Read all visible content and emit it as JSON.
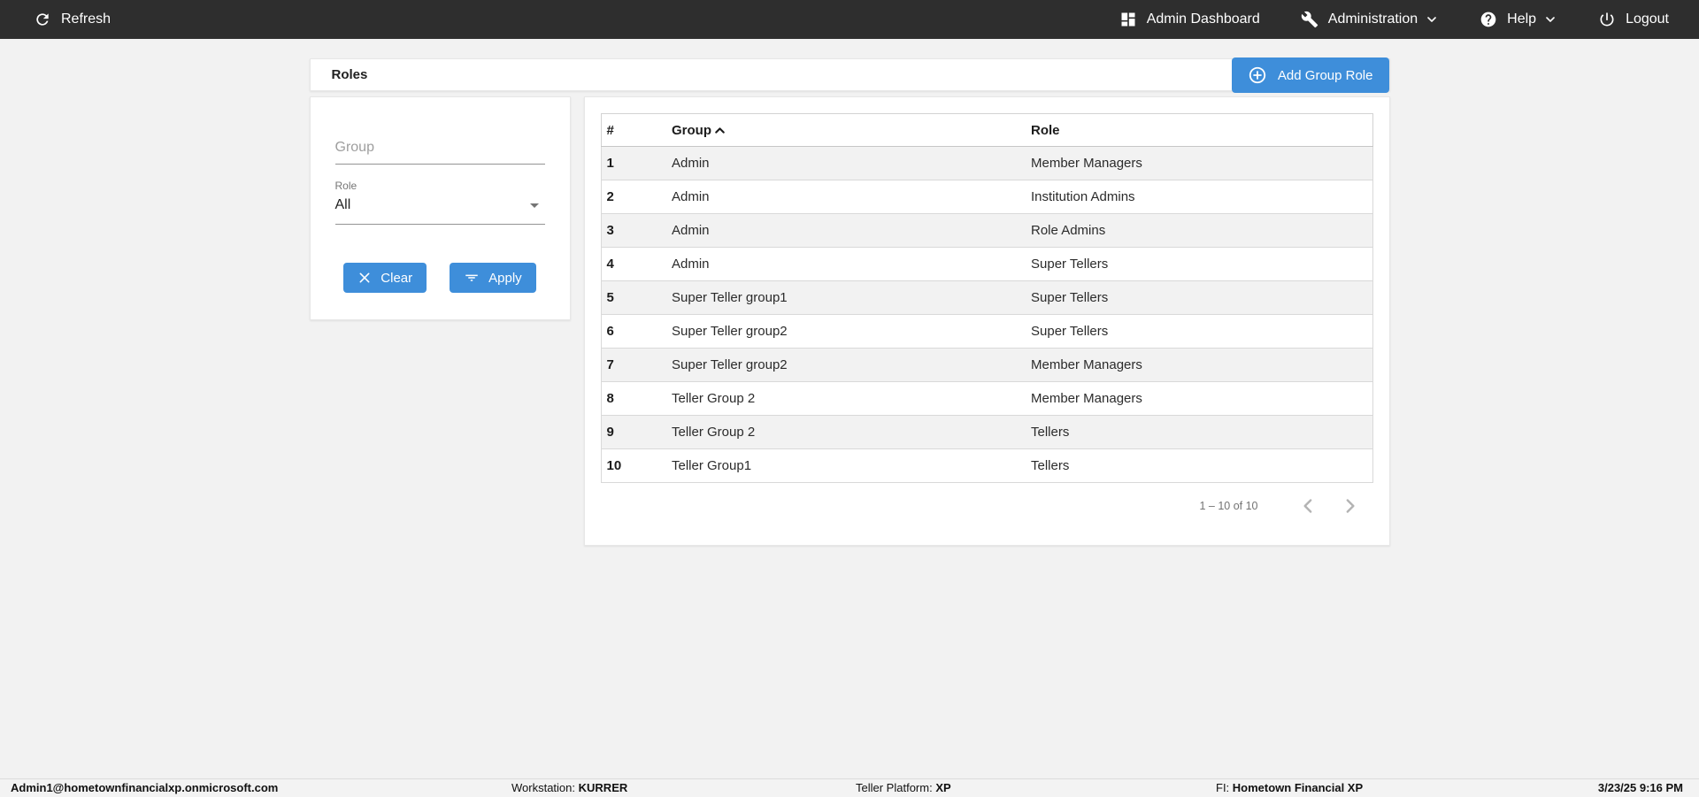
{
  "colors": {
    "primary": "#3e8eda",
    "topbar_bg": "#2e2e2e",
    "page_bg": "#f2f2f2"
  },
  "topbar": {
    "refresh_label": "Refresh",
    "admin_dashboard_label": "Admin Dashboard",
    "administration_label": "Administration",
    "help_label": "Help",
    "logout_label": "Logout",
    "icons": [
      "refresh-icon",
      "dashboard-icon",
      "wrench-icon",
      "help-circle-icon",
      "power-icon",
      "chevron-down-icon"
    ]
  },
  "page": {
    "title": "Roles",
    "add_button_label": "Add Group Role",
    "add_button_icon": "plus-circle-icon"
  },
  "filters": {
    "group_placeholder": "Group",
    "role_label": "Role",
    "role_value": "All",
    "clear_label": "Clear",
    "apply_label": "Apply",
    "clear_icon": "x-icon",
    "apply_icon": "filter-icon",
    "role_caret_icon": "caret-down-icon"
  },
  "table": {
    "columns": [
      "#",
      "Group",
      "Role"
    ],
    "sorted_column": "Group",
    "sort_direction": "asc",
    "sort_icon": "chevron-up-icon",
    "rows": [
      [
        "1",
        "Admin",
        "Member Managers"
      ],
      [
        "2",
        "Admin",
        "Institution Admins"
      ],
      [
        "3",
        "Admin",
        "Role Admins"
      ],
      [
        "4",
        "Admin",
        "Super Tellers"
      ],
      [
        "5",
        "Super Teller group1",
        "Super Tellers"
      ],
      [
        "6",
        "Super Teller group2",
        "Super Tellers"
      ],
      [
        "7",
        "Super Teller group2",
        "Member Managers"
      ],
      [
        "8",
        "Teller Group 2",
        "Member Managers"
      ],
      [
        "9",
        "Teller Group 2",
        "Tellers"
      ],
      [
        "10",
        "Teller Group1",
        "Tellers"
      ]
    ],
    "pagination": {
      "range_text": "1 – 10 of 10",
      "prev_icon": "chevron-left-icon",
      "next_icon": "chevron-right-icon"
    }
  },
  "footer": {
    "user": "Admin1@hometownfinancialxp.onmicrosoft.com",
    "workstation_label": "Workstation:",
    "workstation_value": "KURRER",
    "platform_label": "Teller Platform:",
    "platform_value": "XP",
    "fi_label": "FI:",
    "fi_value": "Hometown Financial XP",
    "datetime": "3/23/25 9:16 PM"
  }
}
